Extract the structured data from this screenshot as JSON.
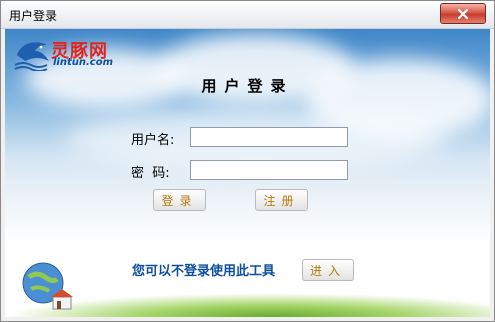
{
  "window": {
    "title": "用户登录"
  },
  "logo": {
    "main": "灵豚网",
    "sub": "lintun.com"
  },
  "form": {
    "heading": "用户登录",
    "username_label": "用户名:",
    "password_label": "密  码:",
    "username_value": "",
    "password_value": ""
  },
  "buttons": {
    "login": "登录",
    "register": "注册",
    "enter": "进入"
  },
  "tip": "您可以不登录使用此工具",
  "colors": {
    "accent_text": "#0d4fa0",
    "button_text": "#b8790c",
    "close_button": "#d7594a"
  },
  "icons": {
    "close": "close-icon",
    "logo": "dolphin-logo",
    "globe": "globe-icon"
  }
}
